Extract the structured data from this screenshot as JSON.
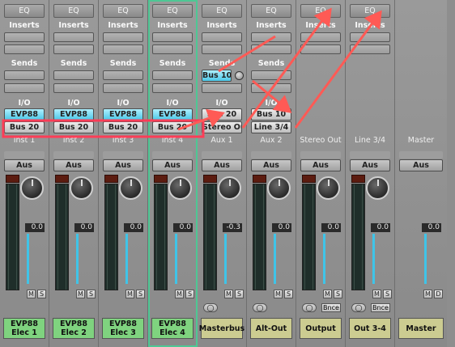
{
  "strips": [
    {
      "eq": "EQ",
      "inserts": "Inserts",
      "sends": "Sends",
      "io": "I/O",
      "input": "EVP88",
      "output": "Bus 20",
      "name_top": "Inst 1",
      "auto": "Aus",
      "vol": "0.0",
      "mute": "M",
      "solo": "S",
      "name": "EVP88 Elec 1",
      "name_color": "green"
    },
    {
      "eq": "EQ",
      "inserts": "Inserts",
      "sends": "Sends",
      "io": "I/O",
      "input": "EVP88",
      "output": "Bus 20",
      "name_top": "Inst 2",
      "auto": "Aus",
      "vol": "0.0",
      "mute": "M",
      "solo": "S",
      "name": "EVP88 Elec 2",
      "name_color": "green"
    },
    {
      "eq": "EQ",
      "inserts": "Inserts",
      "sends": "Sends",
      "io": "I/O",
      "input": "EVP88",
      "output": "Bus 20",
      "name_top": "Inst 3",
      "auto": "Aus",
      "vol": "0.0",
      "mute": "M",
      "solo": "S",
      "name": "EVP88 Elec 3",
      "name_color": "green"
    },
    {
      "eq": "EQ",
      "inserts": "Inserts",
      "sends": "Sends",
      "io": "I/O",
      "input": "EVP88",
      "output": "Bus 20",
      "name_top": "Inst 4",
      "auto": "Aus",
      "vol": "0.0",
      "mute": "M",
      "solo": "S",
      "name": "EVP88 Elec 4",
      "name_color": "green"
    },
    {
      "eq": "EQ",
      "inserts": "Inserts",
      "sends": "Sends",
      "send1": "Bus 10",
      "io": "I/O",
      "input": "Bus 20",
      "output": "Stereo Out",
      "name_top": "Aux 1",
      "auto": "Aus",
      "vol": "-0.3",
      "mute": "M",
      "solo": "S",
      "name": "Masterbus",
      "name_color": "olive"
    },
    {
      "eq": "EQ",
      "inserts": "Inserts",
      "sends": "Sends",
      "io": "I/O",
      "input": "Bus 10",
      "output": "Line 3/4",
      "name_top": "Aux 2",
      "auto": "Aus",
      "vol": "0.0",
      "mute": "M",
      "solo": "S",
      "name": "Alt-Out",
      "name_color": "olive"
    },
    {
      "eq": "EQ",
      "inserts": "Inserts",
      "name_top": "Stereo Out",
      "auto": "Aus",
      "vol": "0.0",
      "mute": "M",
      "solo": "S",
      "bnce": "Bnce",
      "name": "Output",
      "name_color": "olive"
    },
    {
      "eq": "EQ",
      "inserts": "Inserts",
      "name_top": "Line 3/4",
      "auto": "Aus",
      "vol": "0.0",
      "mute": "M",
      "solo": "S",
      "bnce": "Bnce",
      "name": "Out 3-4",
      "name_color": "olive"
    },
    {
      "name_top": "Master",
      "auto": "Aus",
      "vol": "0.0",
      "mute": "M",
      "solo": "D",
      "name": "Master",
      "name_color": "olive"
    }
  ],
  "colors": {
    "annotation": "#ff5a55",
    "selected": "#4ec794",
    "io_blue": "#4cc8e8",
    "name_green": "#7fd37f",
    "name_olive": "#cccc91"
  }
}
